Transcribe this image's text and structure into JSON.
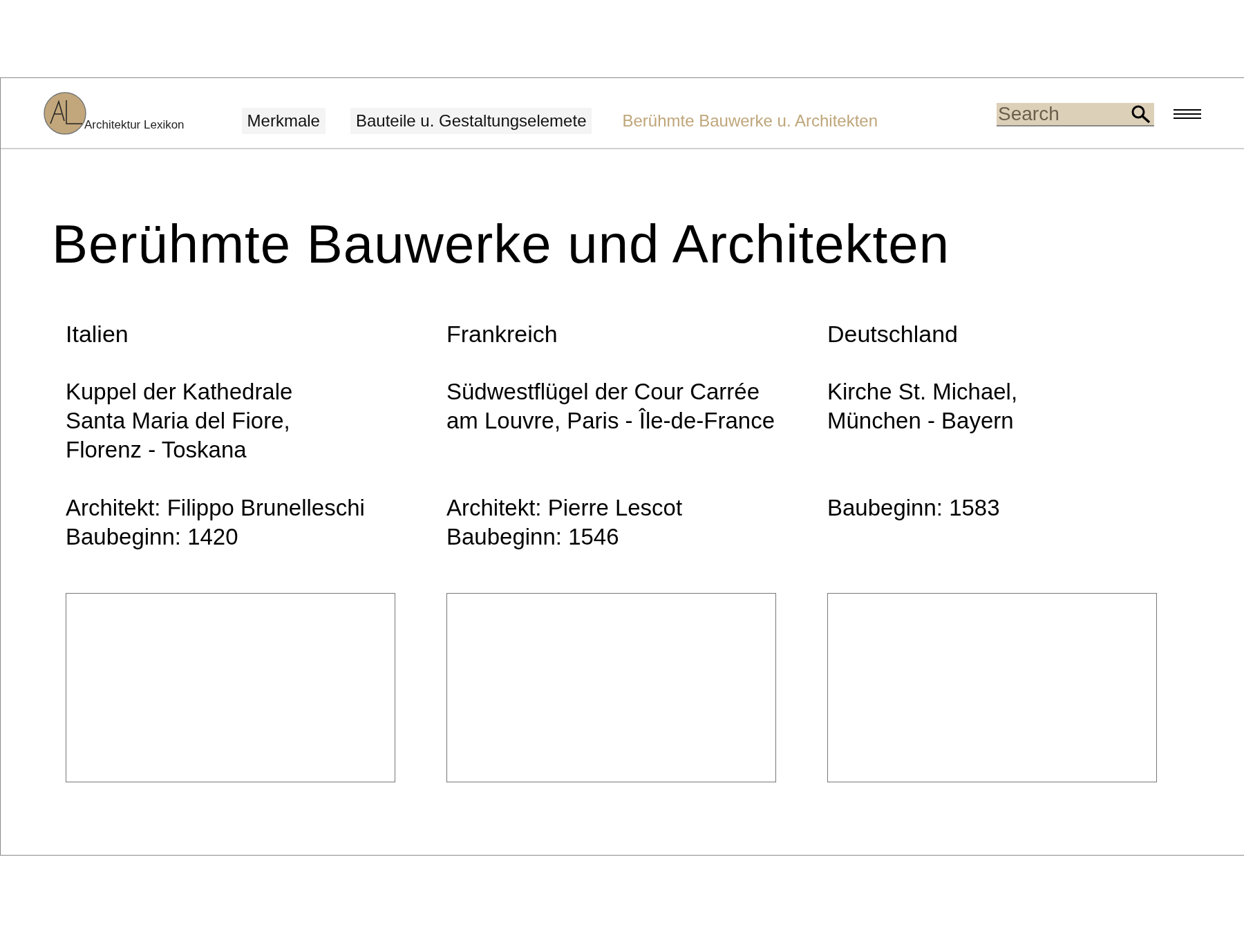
{
  "header": {
    "brand": "Architektur Lexikon",
    "nav": [
      {
        "label": "Merkmale",
        "selected": false
      },
      {
        "label": "Bauteile u. Gestaltungselemete",
        "selected": false
      },
      {
        "label": "Berühmte Bauwerke u. Architekten",
        "selected": true
      }
    ],
    "search": {
      "placeholder": "Search"
    }
  },
  "title": "Berühmte Bauwerke und Architekten",
  "columns": [
    {
      "country": "Italien",
      "building": "Kuppel der Kathedrale\nSanta Maria del Fiore,\nFlorenz - Toskana",
      "details": "Architekt: Filippo Brunelleschi\nBaubeginn: 1420",
      "image": {
        "kind": "placeholder"
      }
    },
    {
      "country": "Frankreich",
      "building": "Südwestflügel der Cour Carrée\nam Louvre, Paris - Île-de-France",
      "details": "Architekt: Pierre Lescot\nBaubeginn: 1546",
      "image": {
        "kind": "placeholder"
      }
    },
    {
      "country": "Deutschland",
      "building": "Kirche St. Michael,\nMünchen - Bayern",
      "details": "Baubeginn: 1583",
      "image": {
        "kind": "placeholder"
      }
    }
  ]
}
